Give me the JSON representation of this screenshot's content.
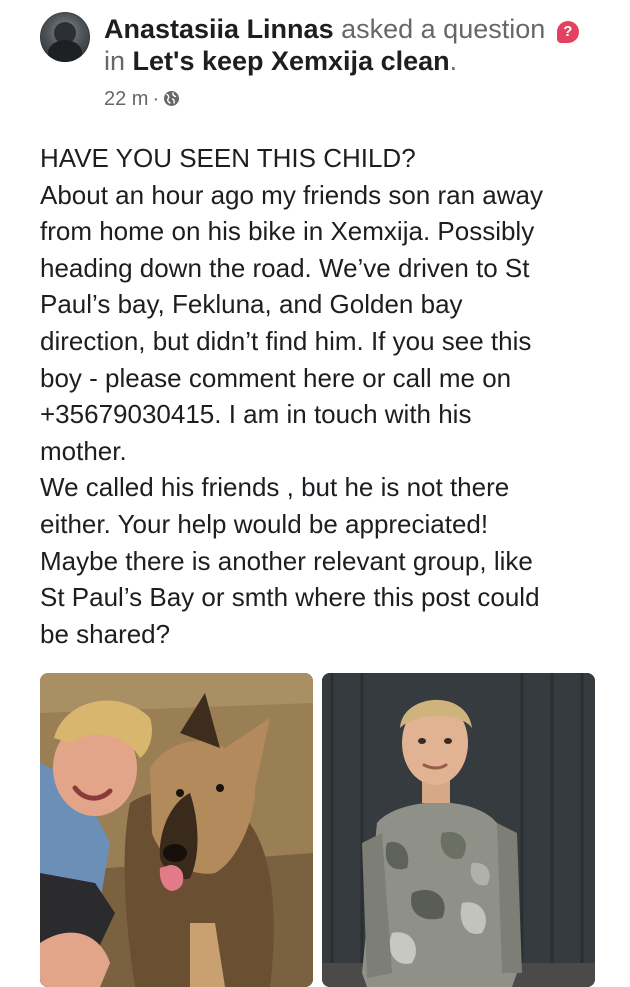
{
  "post": {
    "author": "Anastasiia Linnas",
    "action": "asked a question",
    "in_word": "in",
    "group": "Let's keep Xemxija clean",
    "group_suffix": ".",
    "time": "22 m",
    "separator": "·",
    "question_icon": "question-icon",
    "privacy_icon": "globe-icon",
    "body_lines": [
      "HAVE YOU SEEN THIS CHILD?",
      "About an hour ago my friends son ran away",
      "from home on his bike in Xemxija. Possibly",
      "heading down the road. We’ve driven to St",
      "Paul’s bay, Fekluna, and Golden bay",
      "direction, but didn’t find him. If you see this",
      "boy - please comment here or call me on",
      "+35679030415. I am in touch with his",
      "mother.",
      "We called his friends , but he is not there",
      "either. Your help would be appreciated!",
      "Maybe there is another relevant group, like",
      "St Paul’s Bay or smth where this post could",
      "be shared?"
    ]
  },
  "colors": {
    "text": "#1c1e21",
    "muted": "#65676b",
    "question_badge": "#e4405f"
  }
}
